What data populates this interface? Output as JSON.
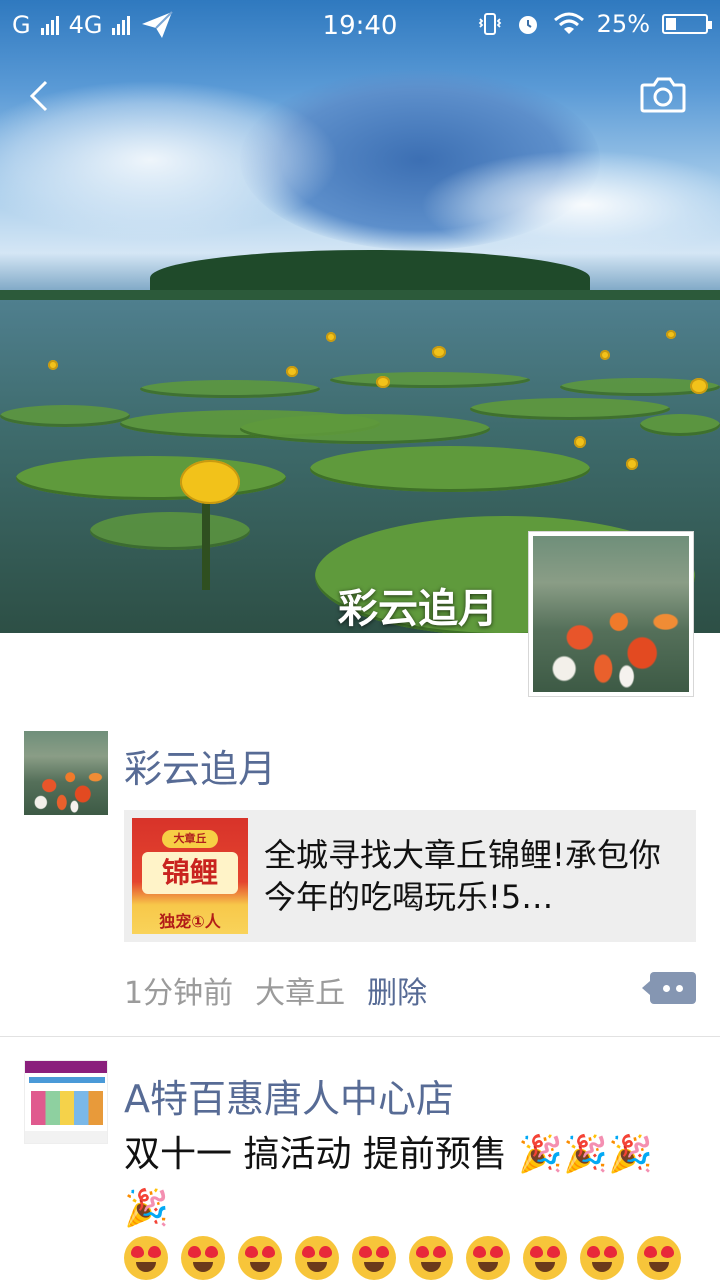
{
  "status_bar": {
    "carrier1": "G",
    "carrier2": "4G",
    "time": "19:40",
    "battery": "25%",
    "battery_level": 0.25
  },
  "header": {
    "back_icon": "chevron-left-icon",
    "camera_icon": "camera-icon"
  },
  "cover": {
    "user_name": "彩云追月"
  },
  "posts": [
    {
      "author": "彩云追月",
      "share": {
        "thumb_badge": "大章丘",
        "thumb_main": "锦鲤",
        "thumb_foot": "独宠①人",
        "title": "全城寻找大章丘锦鲤!承包你今年的吃喝玩乐!5…"
      },
      "time": "1分钟前",
      "location": "大章丘",
      "delete_label": "删除"
    },
    {
      "author": "A特百惠唐人中心店",
      "text": "双十一 搞活动 提前预售 🎉🎉🎉🎉",
      "emoji_count": 10
    }
  ],
  "colors": {
    "link_blue": "#576b95",
    "meta_gray": "#9b9b9b",
    "card_bg": "#eeeeee"
  }
}
